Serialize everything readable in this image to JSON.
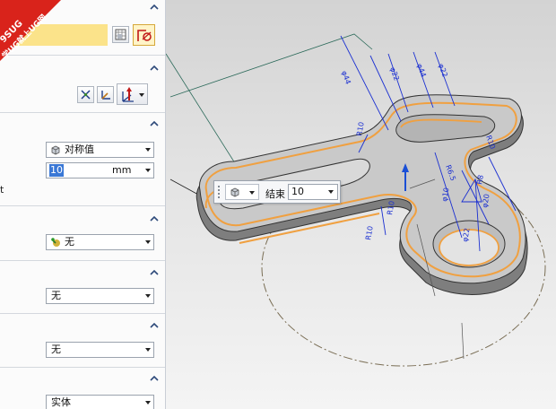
{
  "watermark": {
    "line1": "9SUG",
    "line2": "学UG就上UG网",
    "color": "#d9231b"
  },
  "panel": {
    "accent": "#2e4a7a",
    "selection_highlight": "#fbe38a",
    "limits": {
      "end_type": "对称值",
      "distance_value": "10",
      "unit": "mm",
      "side_label_fragment": "t"
    },
    "boolean": {
      "value": "无"
    },
    "draft": {
      "value": "无"
    },
    "offset": {
      "value": "无"
    },
    "body_type": {
      "value": "实体"
    }
  },
  "onscreen_input": {
    "label": "结束",
    "value": "10"
  },
  "model": {
    "outline_color": "#f0a040",
    "dimension_color": "#1a2fd1",
    "dimensions": [
      "φ44",
      "φ22",
      "φ44",
      "φ22",
      "R10",
      "R10",
      "R10",
      "R10",
      "R8",
      "R8",
      "R6.5",
      "R6.5",
      "φ22",
      "φ20",
      "φ10"
    ]
  }
}
